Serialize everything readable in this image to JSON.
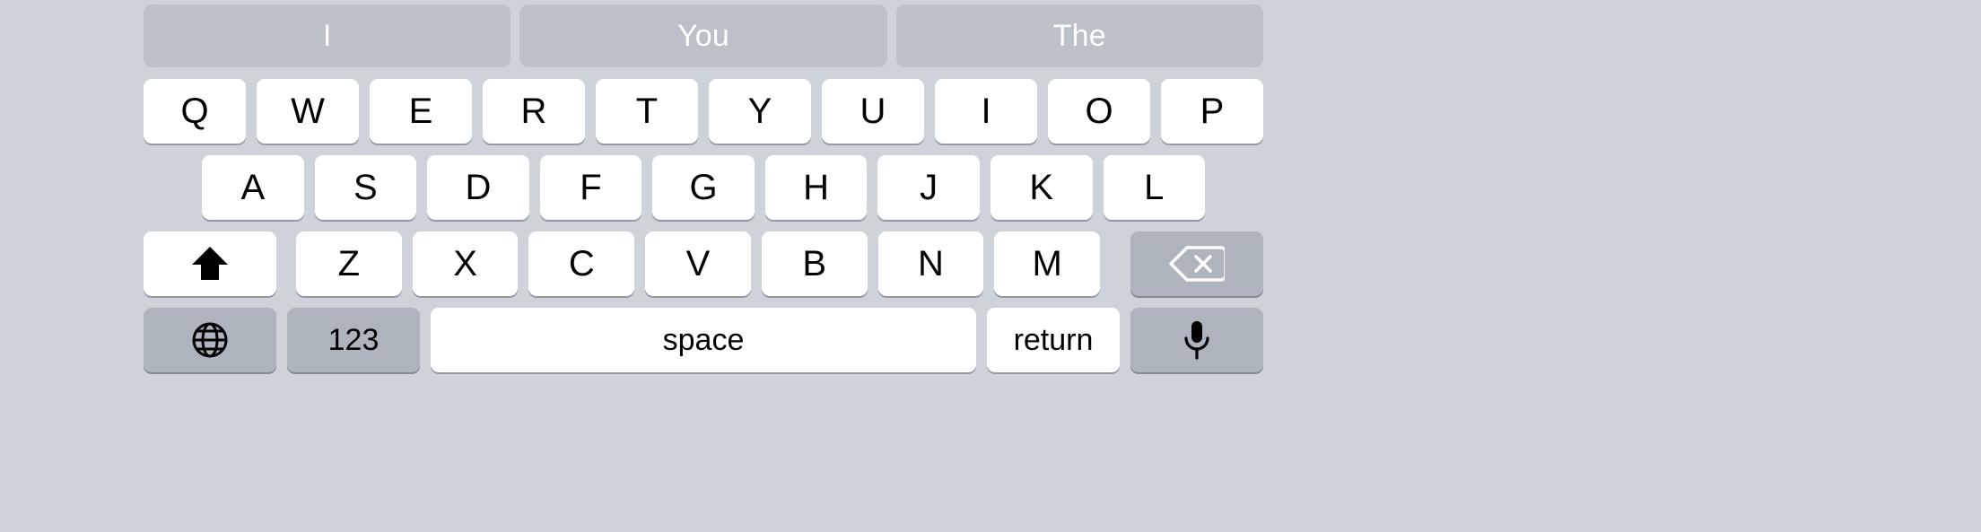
{
  "keyboard": {
    "name": "ios-english-qwerty-keyboard",
    "theme": {
      "background": "#ced2d9",
      "key_light": "#ffffff",
      "key_dark": "#aeb4bd",
      "suggestion_bg": "#bcc1c9",
      "suggestion_text": "#ffffff",
      "key_text": "#000000"
    },
    "suggestion_bar": {
      "name": "predictive-text-bar",
      "suggestions": [
        {
          "label": "I"
        },
        {
          "label": "You"
        },
        {
          "label": "The"
        }
      ]
    },
    "rows": [
      {
        "name": "key-row-1",
        "keys": [
          {
            "label": "Q",
            "icon": "",
            "style": "light",
            "type": "letter"
          },
          {
            "label": "W",
            "icon": "",
            "style": "light",
            "type": "letter"
          },
          {
            "label": "E",
            "icon": "",
            "style": "light",
            "type": "letter"
          },
          {
            "label": "R",
            "icon": "",
            "style": "light",
            "type": "letter"
          },
          {
            "label": "T",
            "icon": "",
            "style": "light",
            "type": "letter"
          },
          {
            "label": "Y",
            "icon": "",
            "style": "light",
            "type": "letter"
          },
          {
            "label": "U",
            "icon": "",
            "style": "light",
            "type": "letter"
          },
          {
            "label": "I",
            "icon": "",
            "style": "light",
            "type": "letter"
          },
          {
            "label": "O",
            "icon": "",
            "style": "light",
            "type": "letter"
          },
          {
            "label": "P",
            "icon": "",
            "style": "light",
            "type": "letter"
          }
        ]
      },
      {
        "name": "key-row-2",
        "keys": [
          {
            "label": "A",
            "icon": "",
            "style": "light",
            "type": "letter"
          },
          {
            "label": "S",
            "icon": "",
            "style": "light",
            "type": "letter"
          },
          {
            "label": "D",
            "icon": "",
            "style": "light",
            "type": "letter"
          },
          {
            "label": "F",
            "icon": "",
            "style": "light",
            "type": "letter"
          },
          {
            "label": "G",
            "icon": "",
            "style": "light",
            "type": "letter"
          },
          {
            "label": "H",
            "icon": "",
            "style": "light",
            "type": "letter"
          },
          {
            "label": "J",
            "icon": "",
            "style": "light",
            "type": "letter"
          },
          {
            "label": "K",
            "icon": "",
            "style": "light",
            "type": "letter"
          },
          {
            "label": "L",
            "icon": "",
            "style": "light",
            "type": "letter"
          }
        ]
      },
      {
        "name": "key-row-3",
        "keys": [
          {
            "label": "",
            "icon": "shift-icon",
            "style": "light",
            "type": "shift"
          },
          {
            "label": "Z",
            "icon": "",
            "style": "light",
            "type": "letter"
          },
          {
            "label": "X",
            "icon": "",
            "style": "light",
            "type": "letter"
          },
          {
            "label": "C",
            "icon": "",
            "style": "light",
            "type": "letter"
          },
          {
            "label": "V",
            "icon": "",
            "style": "light",
            "type": "letter"
          },
          {
            "label": "B",
            "icon": "",
            "style": "light",
            "type": "letter"
          },
          {
            "label": "N",
            "icon": "",
            "style": "light",
            "type": "letter"
          },
          {
            "label": "M",
            "icon": "",
            "style": "light",
            "type": "letter"
          },
          {
            "label": "",
            "icon": "backspace-icon",
            "style": "dark",
            "type": "delete"
          }
        ]
      },
      {
        "name": "key-row-4",
        "keys": [
          {
            "label": "",
            "icon": "globe-icon",
            "style": "dark",
            "type": "globe"
          },
          {
            "label": "123",
            "icon": "",
            "style": "dark",
            "type": "numeric"
          },
          {
            "label": "space",
            "icon": "",
            "style": "light",
            "type": "space"
          },
          {
            "label": "return",
            "icon": "",
            "style": "light",
            "type": "return"
          },
          {
            "label": "",
            "icon": "microphone-icon",
            "style": "dark",
            "type": "mic"
          }
        ]
      }
    ]
  }
}
